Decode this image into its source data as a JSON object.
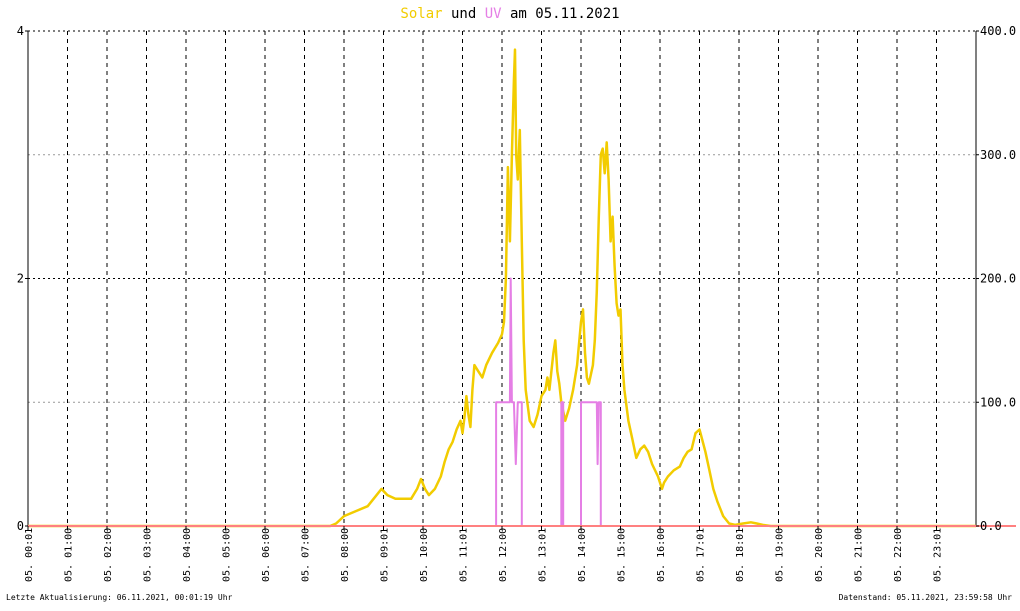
{
  "title": {
    "part1": "Solar",
    "part2": " und ",
    "part3": "UV",
    "part4": " am 05.11.2021"
  },
  "footer": {
    "left": "Letzte Aktualisierung: 06.11.2021, 00:01:19 Uhr",
    "right": "Datenstand: 05.11.2021, 23:59:58 Uhr"
  },
  "colors": {
    "solar": "#f2cc00",
    "uv": "#e57fe5",
    "baseline": "#ff8080",
    "grid": "#000000",
    "background": "#ffffff"
  },
  "chart_data": {
    "type": "line",
    "xlim": [
      0,
      24
    ],
    "x_unit": "hours",
    "y_left": {
      "ylim": [
        0,
        4
      ],
      "ticks": [
        "0",
        "2",
        "4"
      ],
      "series": "UV"
    },
    "y_right": {
      "ylim": [
        0,
        400
      ],
      "ticks": [
        "0.0",
        "100.0",
        "200.0",
        "300.0",
        "400.0"
      ],
      "series": "Solar"
    },
    "x_tick_labels": [
      "05. 00:01",
      "05. 01:00",
      "05. 02:00",
      "05. 03:00",
      "05. 04:00",
      "05. 05:00",
      "05. 06:00",
      "05. 07:00",
      "05. 08:00",
      "05. 09:01",
      "05. 10:00",
      "05. 11:01",
      "05. 12:00",
      "05. 13:01",
      "05. 14:00",
      "05. 15:00",
      "05. 16:00",
      "05. 17:01",
      "05. 18:01",
      "05. 19:00",
      "05. 20:00",
      "05. 21:00",
      "05. 22:00",
      "05. 23:01"
    ],
    "grid": true,
    "series": [
      {
        "name": "Solar",
        "axis": "right",
        "points": [
          [
            0,
            0
          ],
          [
            7.65,
            0
          ],
          [
            7.8,
            2
          ],
          [
            8.0,
            8
          ],
          [
            8.3,
            12
          ],
          [
            8.6,
            16
          ],
          [
            8.8,
            24
          ],
          [
            8.95,
            30
          ],
          [
            9.1,
            25
          ],
          [
            9.3,
            22
          ],
          [
            9.5,
            22
          ],
          [
            9.7,
            22
          ],
          [
            9.85,
            30
          ],
          [
            9.95,
            38
          ],
          [
            10.05,
            30
          ],
          [
            10.15,
            25
          ],
          [
            10.3,
            30
          ],
          [
            10.45,
            40
          ],
          [
            10.55,
            52
          ],
          [
            10.65,
            62
          ],
          [
            10.75,
            68
          ],
          [
            10.85,
            78
          ],
          [
            10.95,
            85
          ],
          [
            11.0,
            75
          ],
          [
            11.05,
            88
          ],
          [
            11.1,
            105
          ],
          [
            11.15,
            90
          ],
          [
            11.2,
            80
          ],
          [
            11.25,
            110
          ],
          [
            11.3,
            130
          ],
          [
            11.4,
            125
          ],
          [
            11.5,
            120
          ],
          [
            11.6,
            130
          ],
          [
            11.75,
            140
          ],
          [
            11.9,
            148
          ],
          [
            12.0,
            155
          ],
          [
            12.05,
            165
          ],
          [
            12.1,
            200
          ],
          [
            12.15,
            290
          ],
          [
            12.2,
            230
          ],
          [
            12.25,
            300
          ],
          [
            12.3,
            360
          ],
          [
            12.33,
            385
          ],
          [
            12.36,
            300
          ],
          [
            12.4,
            280
          ],
          [
            12.45,
            320
          ],
          [
            12.5,
            230
          ],
          [
            12.55,
            150
          ],
          [
            12.6,
            110
          ],
          [
            12.7,
            85
          ],
          [
            12.8,
            80
          ],
          [
            12.9,
            90
          ],
          [
            13.0,
            105
          ],
          [
            13.1,
            110
          ],
          [
            13.15,
            120
          ],
          [
            13.2,
            110
          ],
          [
            13.25,
            125
          ],
          [
            13.3,
            140
          ],
          [
            13.35,
            150
          ],
          [
            13.4,
            125
          ],
          [
            13.45,
            115
          ],
          [
            13.5,
            100
          ],
          [
            13.6,
            85
          ],
          [
            13.7,
            95
          ],
          [
            13.8,
            110
          ],
          [
            13.9,
            130
          ],
          [
            14.0,
            165
          ],
          [
            14.05,
            175
          ],
          [
            14.1,
            140
          ],
          [
            14.15,
            120
          ],
          [
            14.2,
            115
          ],
          [
            14.3,
            130
          ],
          [
            14.35,
            150
          ],
          [
            14.4,
            190
          ],
          [
            14.45,
            250
          ],
          [
            14.5,
            300
          ],
          [
            14.55,
            305
          ],
          [
            14.6,
            285
          ],
          [
            14.65,
            310
          ],
          [
            14.7,
            280
          ],
          [
            14.75,
            230
          ],
          [
            14.8,
            250
          ],
          [
            14.85,
            210
          ],
          [
            14.9,
            180
          ],
          [
            14.95,
            170
          ],
          [
            15.0,
            175
          ],
          [
            15.05,
            130
          ],
          [
            15.1,
            110
          ],
          [
            15.2,
            85
          ],
          [
            15.3,
            70
          ],
          [
            15.4,
            55
          ],
          [
            15.5,
            62
          ],
          [
            15.6,
            65
          ],
          [
            15.7,
            60
          ],
          [
            15.8,
            50
          ],
          [
            15.95,
            40
          ],
          [
            16.05,
            30
          ],
          [
            16.1,
            35
          ],
          [
            16.2,
            40
          ],
          [
            16.35,
            45
          ],
          [
            16.5,
            48
          ],
          [
            16.6,
            55
          ],
          [
            16.7,
            60
          ],
          [
            16.8,
            62
          ],
          [
            16.9,
            75
          ],
          [
            17.0,
            78
          ],
          [
            17.05,
            72
          ],
          [
            17.15,
            60
          ],
          [
            17.25,
            45
          ],
          [
            17.35,
            30
          ],
          [
            17.45,
            20
          ],
          [
            17.6,
            8
          ],
          [
            17.75,
            2
          ],
          [
            17.9,
            1
          ],
          [
            18.1,
            2
          ],
          [
            18.3,
            3
          ],
          [
            18.45,
            2
          ],
          [
            18.6,
            1
          ],
          [
            18.8,
            0
          ],
          [
            24,
            0
          ]
        ]
      },
      {
        "name": "UV",
        "axis": "left",
        "points": [
          [
            0,
            0
          ],
          [
            11.85,
            0
          ],
          [
            11.85,
            1
          ],
          [
            12.2,
            1
          ],
          [
            12.22,
            2
          ],
          [
            12.25,
            1
          ],
          [
            12.3,
            1
          ],
          [
            12.35,
            0.5
          ],
          [
            12.4,
            1
          ],
          [
            12.5,
            1
          ],
          [
            12.5,
            0
          ],
          [
            13.5,
            0
          ],
          [
            13.5,
            1
          ],
          [
            13.55,
            1
          ],
          [
            13.55,
            0
          ],
          [
            14.0,
            0
          ],
          [
            14.0,
            1
          ],
          [
            14.4,
            1
          ],
          [
            14.42,
            0.5
          ],
          [
            14.45,
            1
          ],
          [
            14.5,
            1
          ],
          [
            14.5,
            0
          ],
          [
            24,
            0
          ]
        ]
      }
    ]
  }
}
